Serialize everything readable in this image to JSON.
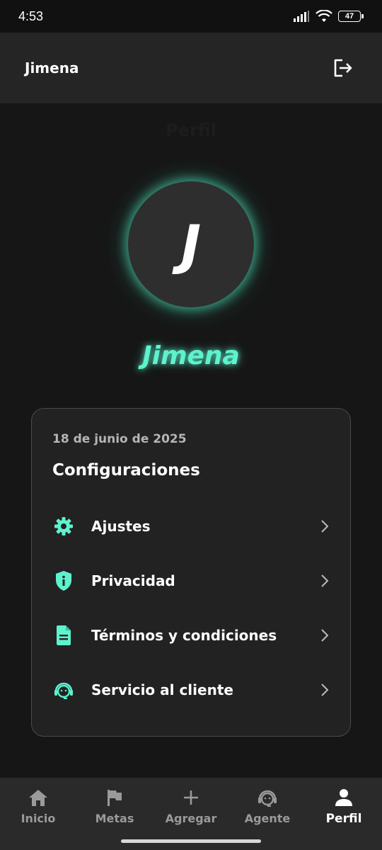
{
  "status_bar": {
    "time": "4:53",
    "battery": "47"
  },
  "header": {
    "user_name": "Jimena",
    "logout_icon": "logout-icon"
  },
  "page": {
    "heading": "Perfil"
  },
  "profile": {
    "initial": "J",
    "name": "Jimena",
    "accent_color": "#5ef2cd"
  },
  "card": {
    "date": "18 de junio de 2025",
    "title": "Configuraciones",
    "items": [
      {
        "label": "Ajustes",
        "icon": "gear-icon"
      },
      {
        "label": "Privacidad",
        "icon": "shield-info-icon"
      },
      {
        "label": "Términos y condiciones",
        "icon": "document-icon"
      },
      {
        "label": "Servicio al cliente",
        "icon": "support-agent-icon"
      }
    ]
  },
  "bottom_nav": {
    "items": [
      {
        "label": "Inicio",
        "icon": "home-icon"
      },
      {
        "label": "Metas",
        "icon": "flag-icon"
      },
      {
        "label": "Agregar",
        "icon": "plus-icon"
      },
      {
        "label": "Agente",
        "icon": "support-agent-icon"
      },
      {
        "label": "Perfil",
        "icon": "person-icon",
        "active": true
      }
    ]
  }
}
